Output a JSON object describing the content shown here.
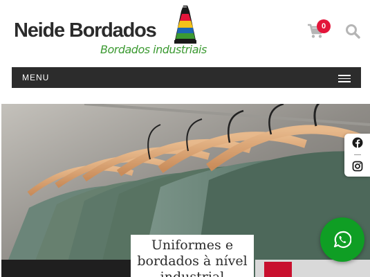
{
  "header": {
    "logo_name": "Neide Bordados",
    "logo_subtitle": "Bordados industriais",
    "cart_count": "0",
    "cart_icon": "shopping-cart-icon",
    "search_icon": "search-icon"
  },
  "menu": {
    "label": "MENU",
    "icon": "hamburger-icon"
  },
  "hero": {
    "caption": "Uniformes e bordados à nível industrial"
  },
  "social": {
    "items": [
      "facebook-icon",
      "instagram-icon"
    ]
  },
  "whatsapp": {
    "icon": "whatsapp-icon"
  },
  "colors": {
    "brand_green": "#3c9a32",
    "menu_bg": "#2c2c2c",
    "badge_red": "#e3153a",
    "whatsapp_green": "#0f9e24",
    "shirt_green": "#5f7a66"
  }
}
